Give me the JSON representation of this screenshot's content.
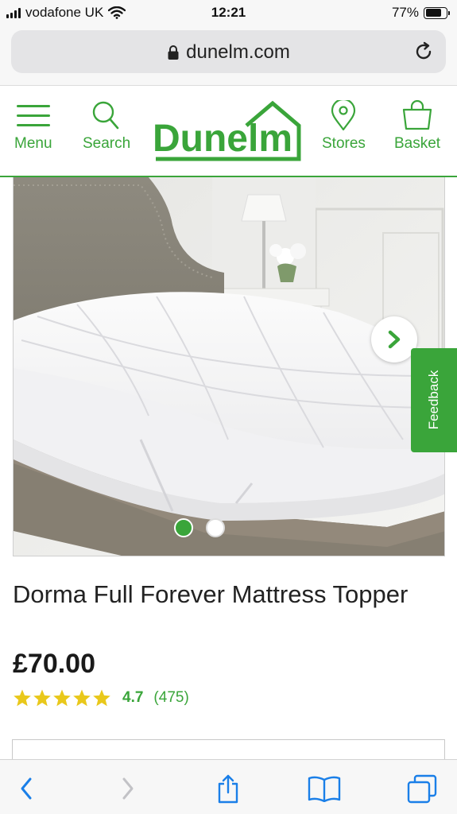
{
  "status_bar": {
    "carrier": "vodafone UK",
    "time": "12:21",
    "battery_percent": "77%",
    "battery_level": 0.77
  },
  "browser": {
    "url": "dunelm.com"
  },
  "header": {
    "menu_label": "Menu",
    "search_label": "Search",
    "logo_text": "Dunelm",
    "stores_label": "Stores",
    "basket_label": "Basket"
  },
  "gallery": {
    "feedback_label": "Feedback",
    "slide_count": 2,
    "active_slide": 1
  },
  "product": {
    "title": "Dorma Full Forever Mattress Topper",
    "price": "£70.00",
    "rating_value": "4.7",
    "review_count": "(475)",
    "rating_stars": 5
  },
  "colors": {
    "brand_green": "#3aa53a",
    "star_yellow": "#e9c81b"
  }
}
